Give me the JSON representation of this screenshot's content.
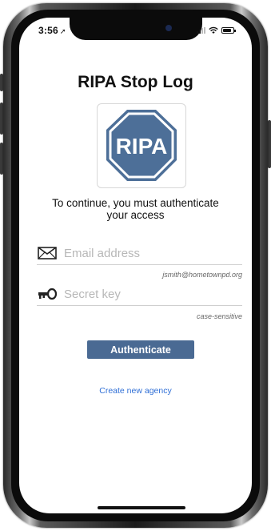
{
  "status_bar": {
    "time": "3:56",
    "location_arrow": "➚"
  },
  "app": {
    "title": "RIPA Stop Log",
    "logo_text": "RIPA",
    "logo_colors": {
      "fill": "#4d6f98",
      "ring": "#ffffff",
      "outer": "#4d6f98"
    },
    "auth_message": "To continue, you must authenticate your access"
  },
  "email_field": {
    "icon": "envelope-icon",
    "placeholder": "Email address",
    "value": "",
    "hint": "jsmith@hometownpd.org"
  },
  "secret_field": {
    "icon": "key-icon",
    "placeholder": "Secret key",
    "value": "",
    "hint": "case-sensitive"
  },
  "actions": {
    "authenticate_label": "Authenticate",
    "create_agency_label": "Create new agency"
  },
  "colors": {
    "button_bg": "#4a6a93",
    "link": "#2f6fd6"
  }
}
